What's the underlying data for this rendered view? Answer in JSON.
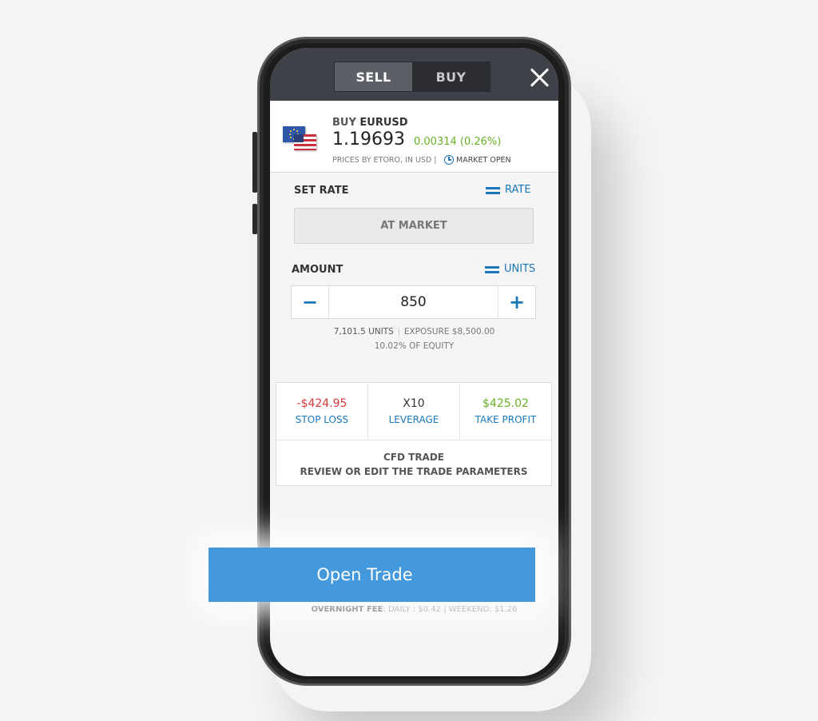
{
  "header": {
    "sell_label": "SELL",
    "buy_label": "BUY"
  },
  "instrument": {
    "action": "BUY",
    "symbol": "EURUSD",
    "price": "1.19693",
    "change": "0.00314",
    "change_pct": "(0.26%)",
    "source": "PRICES BY ETORO, IN USD",
    "separator": "|",
    "status": "MARKET OPEN"
  },
  "rate": {
    "label": "SET RATE",
    "switch_label": "RATE",
    "value": "AT MARKET"
  },
  "amount": {
    "label": "AMOUNT",
    "switch_label": "UNITS",
    "minus": "−",
    "plus": "+",
    "value": "850",
    "units": "7,101.5 UNITS",
    "exposure": "EXPOSURE $8,500.00",
    "equity": "10.02% OF EQUITY"
  },
  "params": {
    "stop_loss_value": "-$424.95",
    "stop_loss_label": "STOP LOSS",
    "leverage_value": "X10",
    "leverage_label": "LEVERAGE",
    "take_profit_value": "$425.02",
    "take_profit_label": "TAKE PROFIT",
    "cfd_title": "CFD TRADE",
    "cfd_subtitle": "REVIEW OR EDIT THE TRADE PARAMETERS"
  },
  "open_trade_label": "Open Trade",
  "fee": {
    "label": "OVERNIGHT FEE",
    "details": ": DAILY : $0.42 | WEEKEND: $1.26"
  },
  "colors": {
    "accent": "#1a77b8",
    "positive": "#6ab023",
    "negative": "#d93a3a",
    "button": "#4399db",
    "topbar": "#3f4148"
  },
  "icons": [
    "close-icon",
    "eu-flag-icon",
    "us-flag-icon",
    "clock-icon",
    "swap-icon"
  ]
}
